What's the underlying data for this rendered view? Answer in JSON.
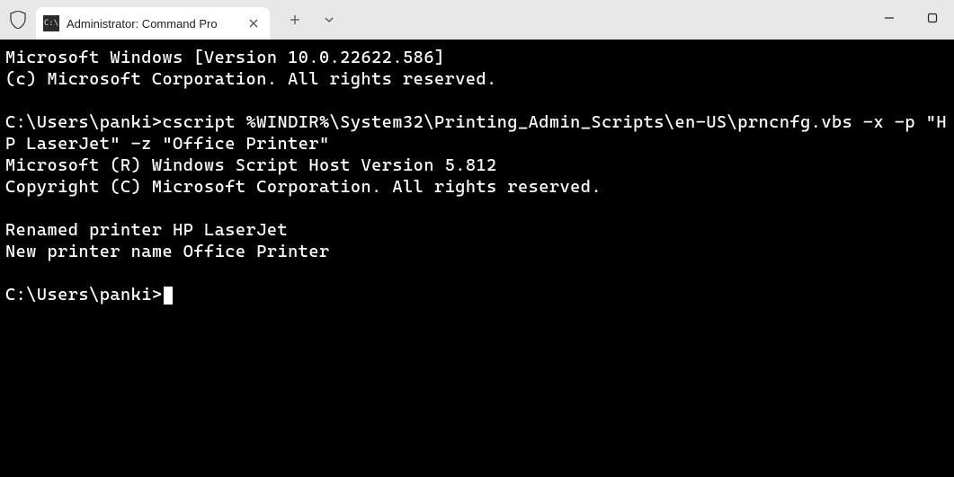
{
  "titlebar": {
    "tab_title": "Administrator: Command Pro",
    "shield_icon": "shield",
    "cmd_icon_text": "C:\\",
    "close_symbol": "✕",
    "plus_symbol": "+",
    "dropdown_symbol": "⌄"
  },
  "window_controls": {
    "minimize": "—",
    "maximize": "▢",
    "close": "✕"
  },
  "terminal": {
    "line1": "Microsoft Windows [Version 10.0.22622.586]",
    "line2": "(c) Microsoft Corporation. All rights reserved.",
    "blank1": "",
    "prompt1": "C:\\Users\\panki>",
    "command1": "cscript %WINDIR%\\System32\\Printing_Admin_Scripts\\en-US\\prncnfg.vbs -x -p \"HP LaserJet\" -z \"Office Printer\"",
    "line3": "Microsoft (R) Windows Script Host Version 5.812",
    "line4": "Copyright (C) Microsoft Corporation. All rights reserved.",
    "blank2": "",
    "line5": "Renamed printer HP LaserJet",
    "line6": "New printer name Office Printer",
    "blank3": "",
    "prompt2": "C:\\Users\\panki>"
  }
}
